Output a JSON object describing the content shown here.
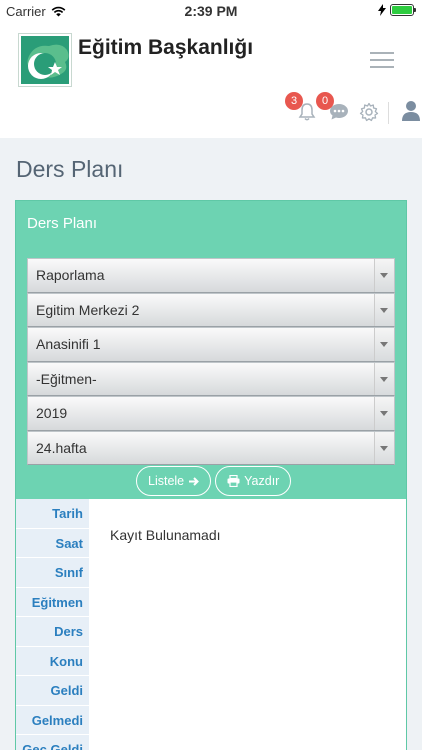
{
  "status_bar": {
    "carrier": "Carrier",
    "time": "2:39 PM",
    "battery_level": 1.0
  },
  "header": {
    "brand": "Eğitim Başkanlığı",
    "notification_count": "3",
    "message_count": "0",
    "accent_color": "#6dd3b2",
    "badge_color": "#e8574f"
  },
  "page": {
    "title": "Ders Planı"
  },
  "panel": {
    "title": "Ders Planı",
    "selects": [
      {
        "value": "Raporlama"
      },
      {
        "value": "Egitim Merkezi 2"
      },
      {
        "value": "Anasinifi 1"
      },
      {
        "value": "-Eğitmen-"
      },
      {
        "value": "2019"
      },
      {
        "value": "24.hafta"
      }
    ],
    "list_button": "Listele",
    "print_button": "Yazdır",
    "columns": [
      "Tarih",
      "Saat",
      "Sınıf",
      "Eğitmen",
      "Ders",
      "Konu",
      "Geldi",
      "Gelmedi",
      "Geç Geldi"
    ],
    "empty_message": "Kayıt Bulunamadı"
  },
  "icons": {
    "wifi": "wifi-icon",
    "bell": "bell-icon",
    "chat": "chat-icon",
    "settings": "gear-icon",
    "user": "user-icon",
    "menu": "hamburger-icon"
  }
}
